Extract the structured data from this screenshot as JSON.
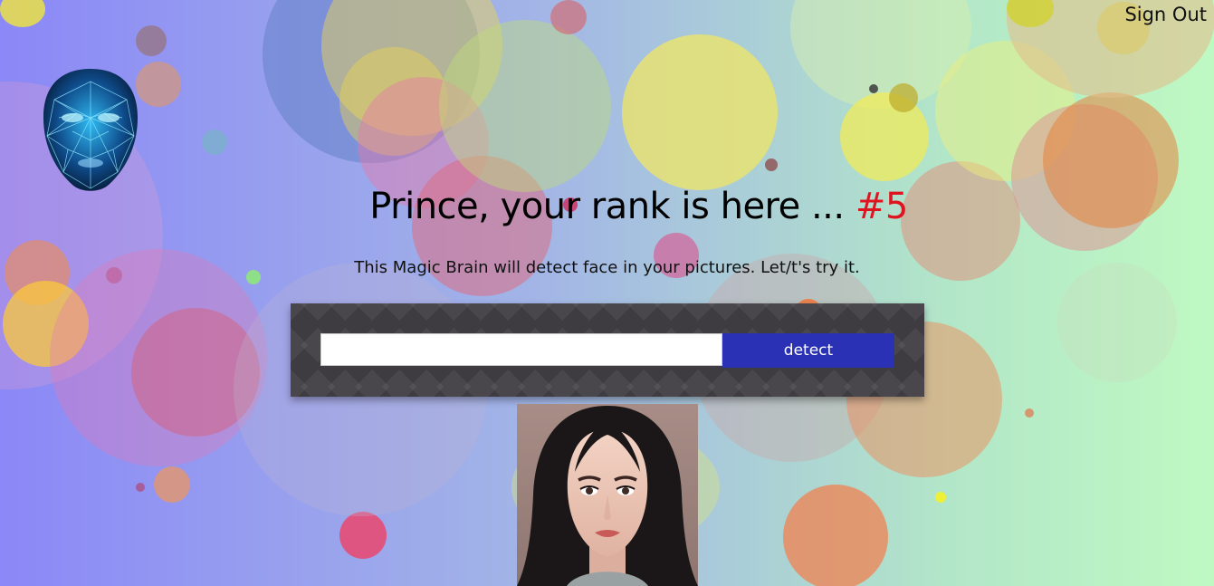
{
  "nav": {
    "sign_out_label": "Sign Out"
  },
  "logo": {
    "icon": "face-mesh-logo-icon"
  },
  "header": {
    "title_prefix": "Prince, your rank is here ... ",
    "rank": "#5",
    "rank_color": "#e0141e"
  },
  "intro": {
    "text": "This Magic Brain will detect face in your pictures. Let/t's try it."
  },
  "form": {
    "url_value": "",
    "url_placeholder": "",
    "detect_label": "detect",
    "button_color": "#2b31b5"
  },
  "image": {
    "icon": "face-portrait-image"
  },
  "colors": {
    "gradient_start": "#8b88f7",
    "gradient_end": "#bff9c2",
    "panel_bg": "#3e3c40"
  }
}
